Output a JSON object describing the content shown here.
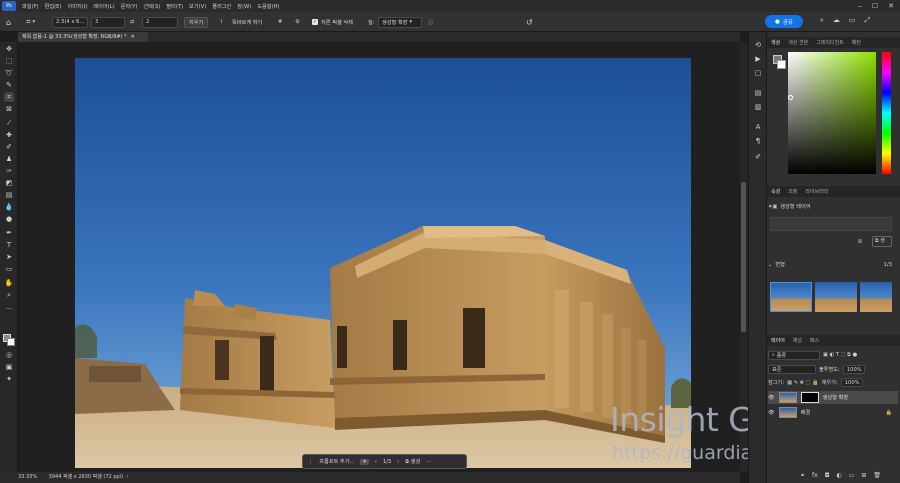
{
  "menubar": {
    "logo": "Ps",
    "items": [
      "파일(F)",
      "편집(E)",
      "이미지(I)",
      "레이어(L)",
      "문자(Y)",
      "선택(S)",
      "필터(T)",
      "보기(V)",
      "플러그인",
      "창(W)",
      "도움말(H)"
    ]
  },
  "options": {
    "ratio": "2:3(4 x 6...",
    "width_value": "3",
    "height_value": "2",
    "clear_button": "지우기",
    "straighten_label": "똑바르게 하기",
    "delete_cropped_label": "자른 픽셀 삭제",
    "fill_label": "칠:",
    "fill_value": "생성형 확장",
    "share_button": "공유"
  },
  "document": {
    "tab_title": "제목 없음-1 @ 33.3%(생성형 확장, RGB/8#) *"
  },
  "context_bar": {
    "prompt_button": "프롬프트 추가...",
    "page": "1/3",
    "generate_button": "생성"
  },
  "status": {
    "zoom": "33.33%",
    "size": "3944 픽셀 x 2630 픽셀 (72 ppi)"
  },
  "color_panel": {
    "tabs": [
      "색상",
      "색상 견본",
      "그레이디언트",
      "패턴"
    ]
  },
  "properties_panel": {
    "tabs": [
      "속성",
      "조정",
      "라이브러리"
    ],
    "layer_type": "생성형 레이어",
    "variations_label": "변형",
    "variations_count": "1/3"
  },
  "layers_panel": {
    "tabs": [
      "레이어",
      "채널",
      "패스"
    ],
    "kind_label": "종류",
    "blend_mode": "표준",
    "opacity_label": "불투명도:",
    "opacity_value": "100%",
    "lock_label": "잠그기:",
    "fill_label": "채우기:",
    "fill_value": "100%",
    "layers": [
      "생성형 확장",
      "배경"
    ]
  },
  "watermark": {
    "title": "Insight Guadian",
    "url": "https://guardians.tistory.com"
  },
  "colors": {
    "accent": "#1473e6",
    "sky_top": "#1c4f96",
    "sky_bottom": "#6a9fd6",
    "stone": "#b8935a"
  }
}
